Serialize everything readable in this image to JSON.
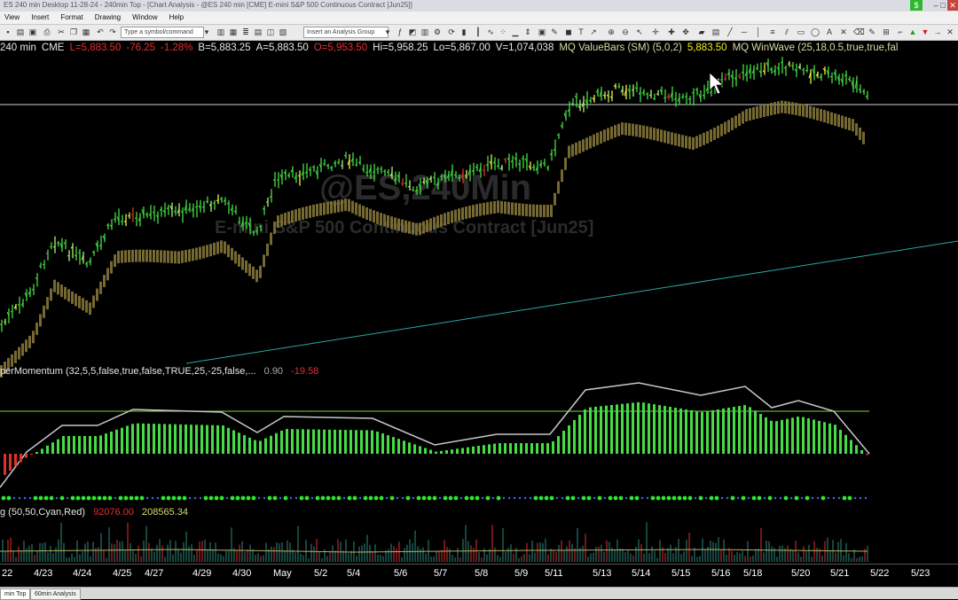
{
  "window": {
    "title": "ES 240 min Desktop 11-28-24 - 240min Top - [Chart Analysis - @ES 240 min [CME] E-mini S&P 500 Continuous Contract [Jun25]]",
    "badge": "$",
    "minimize": "–",
    "restore": "□",
    "close": "✕"
  },
  "menu": [
    "View",
    "Insert",
    "Format",
    "Drawing",
    "Window",
    "Help"
  ],
  "toolbar": {
    "symbol_placeholder": "Type a symbol/command",
    "analysis_placeholder": "Insert an Analysis Group"
  },
  "quote": {
    "interval": "240 min",
    "exchange": "CME",
    "last": "L=5,883.50",
    "change": "-76.25",
    "change_pct": "-1.28%",
    "bid": "B=5,883.25",
    "ask": "A=5,883.50",
    "open": "O=5,953.50",
    "high": "Hi=5,958.25",
    "low": "Lo=5,867.00",
    "volume": "V=1,074,038",
    "study1": "MQ ValueBars (SM) (5,0,2)",
    "study1_value": "5,883.50",
    "study2": "MQ WinWave (25,18,0.5,true,true,fal"
  },
  "watermark": {
    "symbol": "@ES,240Min",
    "name": "E-mini S&P 500 Continuous Contract [Jun25]"
  },
  "indicator1": {
    "label": "perMomentum (32,5,5,false,true,false,TRUE,25,-25,false,...",
    "value1": "0.90",
    "value2": "-19.58"
  },
  "indicator2": {
    "label": "g (50,50,Cyan,Red)",
    "value1": "92076.00",
    "value2": "208565.34"
  },
  "date_axis": [
    "22",
    "4/23",
    "4/24",
    "4/25",
    "4/27",
    "4/29",
    "4/30",
    "May",
    "5/2",
    "5/4",
    "5/6",
    "5/7",
    "5/8",
    "5/9",
    "5/11",
    "5/13",
    "5/14",
    "5/15",
    "5/16",
    "5/18",
    "5/20",
    "5/21",
    "5/22",
    "5/23"
  ],
  "tabs": [
    "min Top",
    "60min Analysis"
  ],
  "colors": {
    "up_bar": "#44dd44",
    "up_bar_light": "#b8f07a",
    "yellow_bar": "#f4f040",
    "down_bar": "#e03030",
    "wave": "#8a7a3a",
    "trendline": "#2aa8a0",
    "oscillator_line": "#c8c8c8",
    "zero_line": "#7fcf3f",
    "dot_green": "#2ee82e",
    "dot_blue": "#4466ff",
    "volume": "#2b8a80",
    "volume_avg": "#b8b060"
  }
}
